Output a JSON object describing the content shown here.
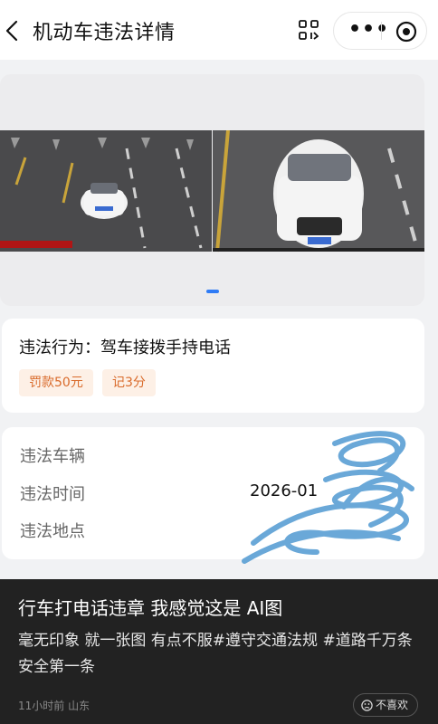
{
  "header": {
    "title": "机动车违法详情",
    "more": "•••"
  },
  "violation": {
    "behavior_label": "违法行为：驾车接拨手持电话",
    "tags": [
      "罚款50元",
      "记3分"
    ]
  },
  "details": {
    "rows": [
      {
        "label": "违法车辆",
        "value": ""
      },
      {
        "label": "违法时间",
        "value": "2026-01"
      },
      {
        "label": "违法地点",
        "value": ""
      }
    ]
  },
  "post": {
    "title": "行车打电话违章 我感觉这是 AI图",
    "body": "毫无印象 就一张图 有点不服#遵守交通法规 #道路千万条安全第一条",
    "meta": "11小时前 山东",
    "dislike": "不喜欢"
  },
  "colors": {
    "accent": "#2f7cf6",
    "tag_text": "#d96a2a",
    "tag_bg": "#fdf0e6",
    "scribble": "#5a9fd4"
  }
}
